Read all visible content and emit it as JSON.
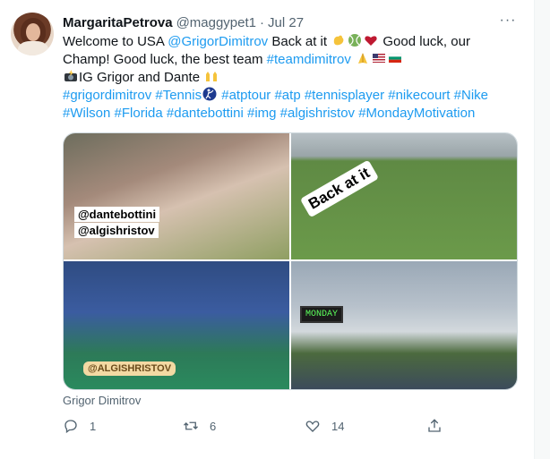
{
  "tweet": {
    "author_name": "MargaritaPetrova",
    "handle": "@maggypet1",
    "separator": "·",
    "date": "Jul 27",
    "more_label": "···",
    "text": {
      "l1_pre": "Welcome to USA ",
      "l1_mention": "@GrigorDimitrov",
      "l1_mid": " Back at it ",
      "l1_post": " Good luck, our",
      "l2_pre": "Champ! Good luck, the best team ",
      "l2_tag": "#teamdimitrov",
      "l3": "IG Grigor and Dante",
      "l4_t1": "#grigordimitrov",
      "l4_t2": "#Tennis",
      "l4_t3": "#atptour",
      "l4_t4": "#atp",
      "l4_t5": "#tennisplayer",
      "l4_t6": "#nikecourt",
      "l4_t7": "#Nike",
      "l5_t1": "#Wilson",
      "l5_t2": "#Florida",
      "l5_t3": "#dantebottini",
      "l5_t4": "#img",
      "l5_t5": "#algishristov",
      "l5_t6": "#MondayMotivation"
    },
    "media": {
      "photo1_tags": [
        "@dantebottini",
        "@algishristov"
      ],
      "photo2_sticker": "Back at it",
      "photo3_tag": "@ALGISHRISTOV",
      "photo4_sign": "MONDAY"
    },
    "media_caption": "Grigor Dimitrov",
    "actions": {
      "reply_count": "1",
      "retweet_count": "6",
      "like_count": "14"
    }
  },
  "colors": {
    "link": "#1d9bf0",
    "text": "#0f1419",
    "muted": "#536471"
  },
  "icons": [
    "more-icon",
    "flexed-biceps-emoji",
    "tennis-ball-emoji",
    "red-heart-emoji",
    "folded-hands-emoji",
    "us-flag-emoji",
    "bulgaria-flag-emoji",
    "camera-flash-emoji",
    "raising-hands-emoji",
    "tennis-player-emoji",
    "reply-icon",
    "retweet-icon",
    "like-icon",
    "share-icon"
  ]
}
